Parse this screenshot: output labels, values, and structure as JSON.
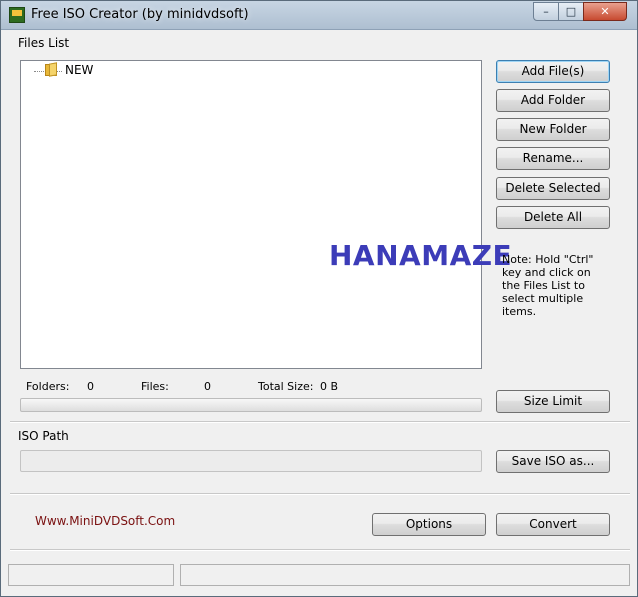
{
  "window": {
    "title": "Free ISO Creator (by minidvdsoft)",
    "controls": {
      "minimize": "–",
      "maximize": "□",
      "close": "✕"
    }
  },
  "files_list": {
    "label": "Files List",
    "items": [
      {
        "label": "NEW",
        "icon": "folder-icon"
      }
    ]
  },
  "buttons": {
    "add_files": "Add File(s)",
    "add_folder": "Add Folder",
    "new_folder": "New Folder",
    "rename": "Rename...",
    "delete_selected": "Delete Selected",
    "delete_all": "Delete All",
    "size_limit": "Size Limit",
    "save_iso_as": "Save ISO as...",
    "options": "Options",
    "convert": "Convert"
  },
  "note": "Note: Hold \"Ctrl\" key and click on the Files List to select multiple items.",
  "watermark": "HANAMAZE",
  "stats": {
    "folders_label": "Folders:",
    "folders_value": "0",
    "files_label": "Files:",
    "files_value": "0",
    "total_size_label": "Total Size:",
    "total_size_value": "0 B"
  },
  "progress": {
    "value": 0
  },
  "iso_path": {
    "label": "ISO Path",
    "value": ""
  },
  "website": "Www.MiniDVDSoft.Com",
  "colors": {
    "watermark": "#3c3cb8",
    "link": "#7a1010",
    "default_button_border": "#3c7fb1"
  }
}
